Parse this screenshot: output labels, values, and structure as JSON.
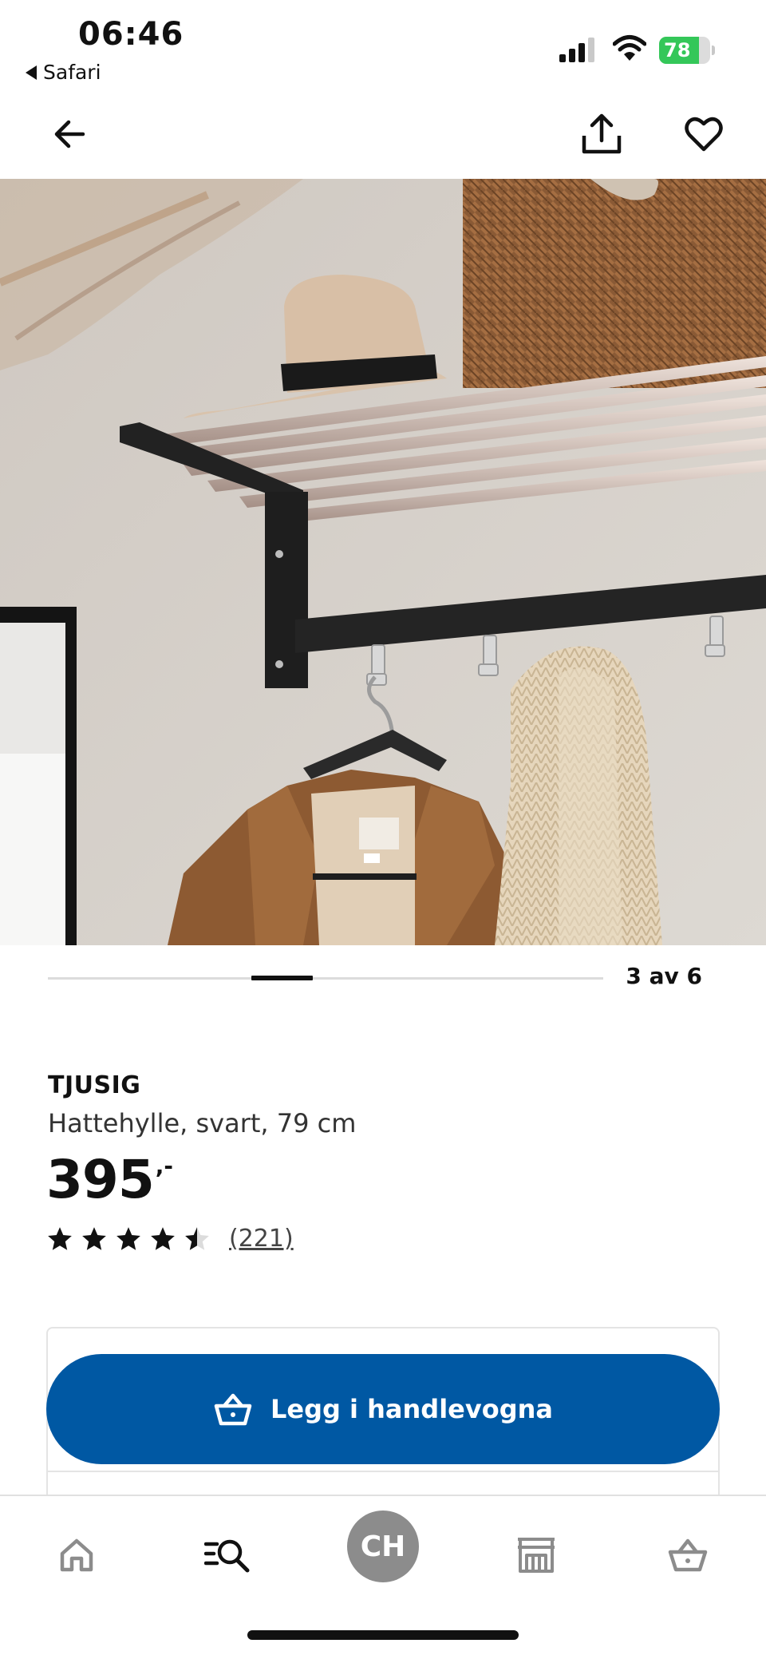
{
  "status_bar": {
    "time": "06:46",
    "back_app": "Safari",
    "battery_level": 78,
    "battery_charging": true,
    "icons": [
      "cellular-signal-icon",
      "wifi-icon",
      "battery-icon"
    ]
  },
  "navbar": {
    "icons": [
      "arrow-left-icon",
      "share-icon",
      "heart-icon"
    ]
  },
  "carousel": {
    "current": 3,
    "total": 6,
    "label": "3 av 6"
  },
  "product": {
    "name": "TJUSIG",
    "description": "Hattehylle, svart, 79 cm",
    "price": "395",
    "price_suffix": ",-",
    "rating": 4.5,
    "rating_max": 5,
    "reviews_label": "(221)"
  },
  "buy": {
    "add_to_cart_label": "Legg i handlevogna",
    "icon": "shopping-basket-icon"
  },
  "tab_bar": {
    "tabs": [
      {
        "name": "home",
        "icon": "home-icon"
      },
      {
        "name": "search",
        "icon": "search-list-icon"
      },
      {
        "name": "profile",
        "avatar_initials": "CH"
      },
      {
        "name": "stores",
        "icon": "store-icon"
      },
      {
        "name": "cart",
        "icon": "basket-icon"
      }
    ]
  },
  "colors": {
    "brand_blue": "#0058a3",
    "battery_green": "#34c759",
    "avatar_gray": "#8c8c8c"
  }
}
